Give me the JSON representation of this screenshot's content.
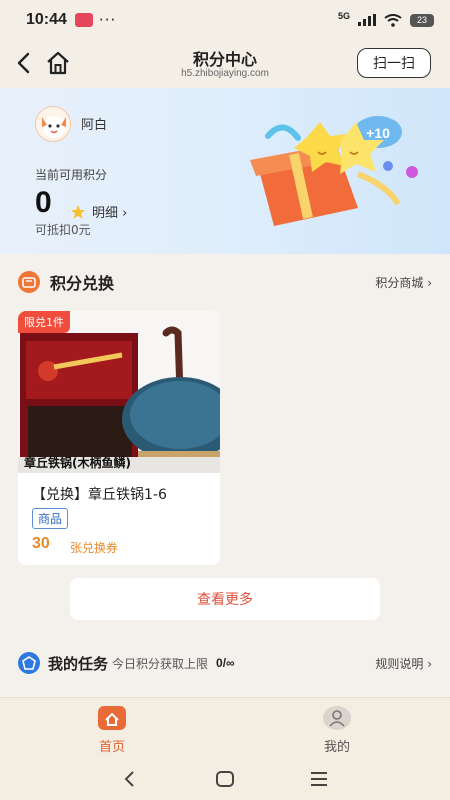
{
  "status_bar": {
    "time": "10:44",
    "dots": "···",
    "network": "5G",
    "battery": "23"
  },
  "header": {
    "title": "积分中心",
    "url": "h5.zhibojiaying.com",
    "scan_label": "扫一扫"
  },
  "points_card": {
    "username": "阿白",
    "points_label": "当前可用积分",
    "points_value": "0",
    "detail_label": "明细 ›",
    "deduct_text": "可抵扣0元",
    "gift_badge": "+10"
  },
  "exchange": {
    "title": "积分兑换",
    "mall_link": "积分商城 ›",
    "products": [
      {
        "limit_badge": "限兑1件",
        "image_caption": "章丘铁锅(木柄鱼鳞)",
        "name": "【兑换】章丘铁锅1-6",
        "tag": "商品",
        "price": "30",
        "unit": "张兑换券"
      }
    ],
    "see_more": "查看更多"
  },
  "tasks": {
    "title": "我的任务",
    "subtitle": "今日积分获取上限",
    "count": "0/∞",
    "rules_link": "规则说明 ›"
  },
  "tabbar": {
    "items": [
      {
        "label": "首页"
      },
      {
        "label": "我的"
      }
    ]
  },
  "colors": {
    "accent": "#e0602e",
    "price": "#e88a2c",
    "tag_blue": "#2e6bc0",
    "card_bg": "#dfeefc"
  }
}
